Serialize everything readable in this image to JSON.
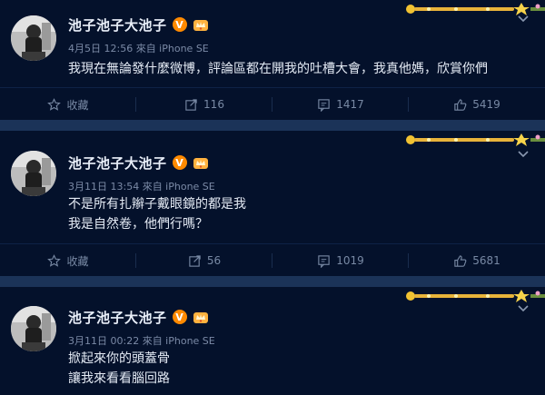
{
  "posts": [
    {
      "author": "池子池子大池子",
      "verified_badge": "V",
      "meta": "4月5日 12:56 來自 iPhone SE",
      "lines": [
        "我現在無論發什麼微博，評論區都在開我的吐槽大會，我真他媽，欣賞你們"
      ],
      "actions": {
        "collect_label": "收藏",
        "repost_count": "116",
        "comment_count": "1417",
        "like_count": "5419"
      }
    },
    {
      "author": "池子池子大池子",
      "verified_badge": "V",
      "meta": "3月11日 13:54 來自 iPhone SE",
      "lines": [
        "不是所有扎辮子戴眼鏡的都是我",
        "我是自然卷，他們行嗎？"
      ],
      "actions": {
        "collect_label": "收藏",
        "repost_count": "56",
        "comment_count": "1019",
        "like_count": "5681"
      }
    },
    {
      "author": "池子池子大池子",
      "verified_badge": "V",
      "meta": "3月11日 00:22 來自 iPhone SE",
      "lines": [
        "掀起來你的頭蓋骨",
        "讓我來看看腦回路"
      ]
    }
  ],
  "colors": {
    "background": "#04112b",
    "separator": "#1b3358",
    "badge": "#ff8a00",
    "muted_text": "#7b8aa6"
  },
  "icons": [
    "star-icon",
    "repost-icon",
    "comment-icon",
    "thumbs-up-icon",
    "chevron-down-icon",
    "crown-badge-icon",
    "avatar"
  ]
}
